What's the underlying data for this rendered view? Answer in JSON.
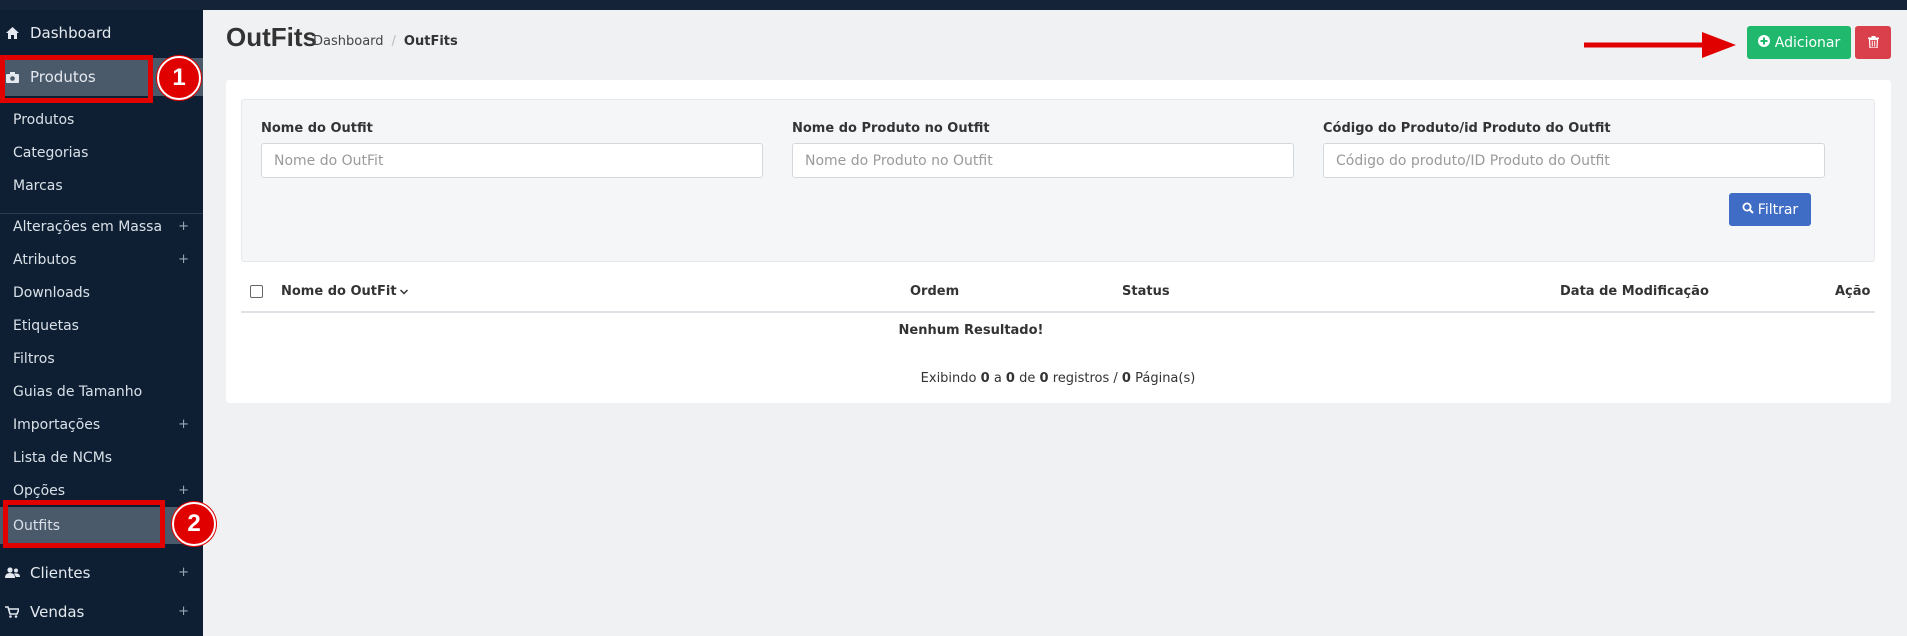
{
  "sidebar": {
    "dashboard": "Dashboard",
    "produtos": "Produtos",
    "sub_items": [
      {
        "label": "Produtos",
        "has_plus": false
      },
      {
        "label": "Categorias",
        "has_plus": false
      },
      {
        "label": "Marcas",
        "has_plus": false
      },
      {
        "label": "Alterações em Massa",
        "has_plus": true
      },
      {
        "label": "Atributos",
        "has_plus": true
      },
      {
        "label": "Downloads",
        "has_plus": false
      },
      {
        "label": "Etiquetas",
        "has_plus": false
      },
      {
        "label": "Filtros",
        "has_plus": false
      },
      {
        "label": "Guias de Tamanho",
        "has_plus": false
      },
      {
        "label": "Importações",
        "has_plus": true
      },
      {
        "label": "Lista de NCMs",
        "has_plus": false
      },
      {
        "label": "Opções",
        "has_plus": true
      },
      {
        "label": "Outfits",
        "has_plus": false
      }
    ],
    "clientes": "Clientes",
    "vendas": "Vendas",
    "plus": "+"
  },
  "annotations": {
    "badge1": "1",
    "badge2": "2"
  },
  "header": {
    "title": "OutFits",
    "breadcrumb": {
      "home": "Dashboard",
      "separator": "/",
      "current": "OutFits"
    },
    "add_label": "Adicionar"
  },
  "filters": {
    "name_label": "Nome do Outfit",
    "name_placeholder": "Nome do OutFit",
    "product_label": "Nome do Produto no Outfit",
    "product_placeholder": "Nome do Produto no Outfit",
    "code_label": "Código do Produto/id Produto do Outfit",
    "code_placeholder": "Código do produto/ID Produto do Outfit",
    "filter_label": "Filtrar"
  },
  "table": {
    "columns": {
      "name": "Nome do OutFit",
      "order": "Ordem",
      "status": "Status",
      "modified": "Data de Modificação",
      "action": "Ação"
    },
    "empty": "Nenhum Resultado!",
    "pagination": {
      "prefix": "Exibindo",
      "from": "0",
      "to_word": "a",
      "to": "0",
      "of_word": "de",
      "total": "0",
      "records_word": "registros /",
      "pages": "0",
      "pages_word": "Página(s)"
    }
  },
  "colors": {
    "sidebar_bg": "#0e1f33",
    "add_green": "#1fb86d",
    "delete_red": "#d9404b",
    "filter_blue": "#3f6cc4",
    "annotation_red": "#e00000"
  }
}
